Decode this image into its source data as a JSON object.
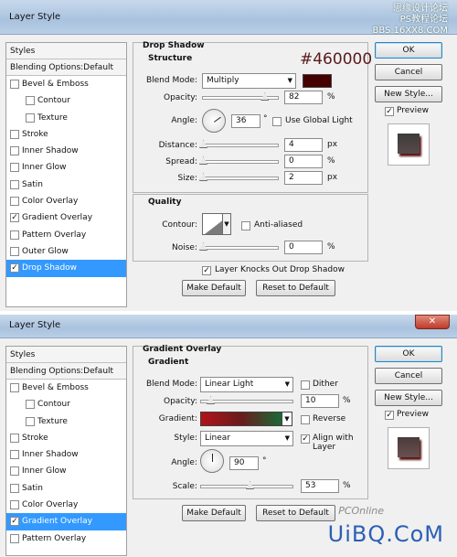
{
  "watermark": {
    "line1": "思缘设计论坛",
    "line2": "PS教程论坛",
    "line3": "BBS.16XX8.COM"
  },
  "dialog1": {
    "title": "Layer Style",
    "styles_header": "Styles",
    "blending_options": "Blending Options:Default",
    "style_items": [
      {
        "label": "Bevel & Emboss",
        "checked": "",
        "sub": false
      },
      {
        "label": "Contour",
        "checked": "",
        "sub": true
      },
      {
        "label": "Texture",
        "checked": "",
        "sub": true
      },
      {
        "label": "Stroke",
        "checked": "",
        "sub": false
      },
      {
        "label": "Inner Shadow",
        "checked": "",
        "sub": false
      },
      {
        "label": "Inner Glow",
        "checked": "",
        "sub": false
      },
      {
        "label": "Satin",
        "checked": "",
        "sub": false
      },
      {
        "label": "Color Overlay",
        "checked": "",
        "sub": false
      },
      {
        "label": "Gradient Overlay",
        "checked": "✓",
        "sub": false
      },
      {
        "label": "Pattern Overlay",
        "checked": "",
        "sub": false
      },
      {
        "label": "Outer Glow",
        "checked": "",
        "sub": false
      },
      {
        "label": "Drop Shadow",
        "checked": "✓",
        "sub": false,
        "selected": true
      }
    ],
    "section_title": "Drop Shadow",
    "structure_title": "Structure",
    "blend_mode_label": "Blend Mode:",
    "blend_mode_value": "Multiply",
    "shadow_color": "#460000",
    "color_annotation": "#460000",
    "opacity_label": "Opacity:",
    "opacity_value": "82",
    "opacity_unit": "%",
    "opacity_fraction": 0.82,
    "angle_label": "Angle:",
    "angle_value": "36",
    "angle_unit": "°",
    "use_global_light": "Use Global Light",
    "distance_label": "Distance:",
    "distance_value": "4",
    "distance_unit": "px",
    "spread_label": "Spread:",
    "spread_value": "0",
    "spread_unit": "%",
    "size_label": "Size:",
    "size_value": "2",
    "size_unit": "px",
    "quality_title": "Quality",
    "contour_label": "Contour:",
    "anti_aliased": "Anti-aliased",
    "noise_label": "Noise:",
    "noise_value": "0",
    "noise_unit": "%",
    "layer_knocks_out": "Layer Knocks Out Drop Shadow",
    "make_default": "Make Default",
    "reset_to_default": "Reset to Default",
    "ok": "OK",
    "cancel": "Cancel",
    "new_style": "New Style...",
    "preview": "Preview"
  },
  "dialog2": {
    "title": "Layer Style",
    "styles_header": "Styles",
    "blending_options": "Blending Options:Default",
    "style_items": [
      {
        "label": "Bevel & Emboss",
        "checked": "",
        "sub": false
      },
      {
        "label": "Contour",
        "checked": "",
        "sub": true
      },
      {
        "label": "Texture",
        "checked": "",
        "sub": true
      },
      {
        "label": "Stroke",
        "checked": "",
        "sub": false
      },
      {
        "label": "Inner Shadow",
        "checked": "",
        "sub": false
      },
      {
        "label": "Inner Glow",
        "checked": "",
        "sub": false
      },
      {
        "label": "Satin",
        "checked": "",
        "sub": false
      },
      {
        "label": "Color Overlay",
        "checked": "",
        "sub": false
      },
      {
        "label": "Gradient Overlay",
        "checked": "✓",
        "sub": false,
        "selected": true
      },
      {
        "label": "Pattern Overlay",
        "checked": "",
        "sub": false
      }
    ],
    "section_title": "Gradient Overlay",
    "gradient_title": "Gradient",
    "blend_mode_label": "Blend Mode:",
    "blend_mode_value": "Linear Light",
    "dither": "Dither",
    "opacity_label": "Opacity:",
    "opacity_value": "10",
    "opacity_unit": "%",
    "opacity_fraction": 0.1,
    "gradient_label": "Gradient:",
    "reverse": "Reverse",
    "style_label": "Style:",
    "style_value": "Linear",
    "align_with_layer": "Align with Layer",
    "angle_label": "Angle:",
    "angle_value": "90",
    "angle_unit": "°",
    "scale_label": "Scale:",
    "scale_value": "53",
    "scale_unit": "%",
    "scale_fraction": 0.53,
    "make_default": "Make Default",
    "reset_to_default": "Reset to Default",
    "ok": "OK",
    "cancel": "Cancel",
    "new_style": "New Style...",
    "preview": "Preview"
  },
  "logo": {
    "pconline": "PCOnline",
    "uibq": "UiBQ.CoM"
  }
}
